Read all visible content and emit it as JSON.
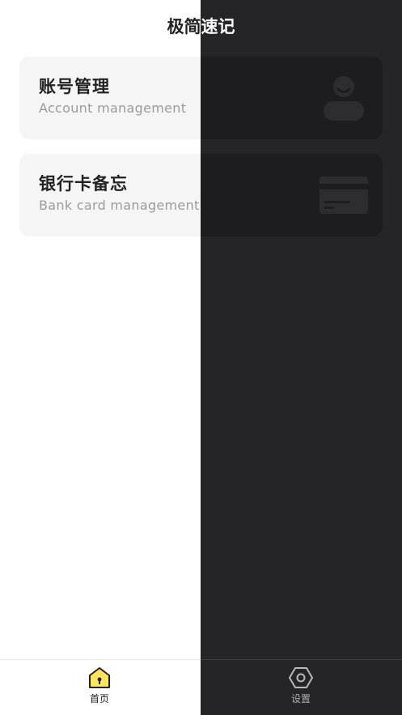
{
  "header": {
    "title": "极简速记"
  },
  "cards": [
    {
      "title": "账号管理",
      "subtitle": "Account management",
      "icon": "user-icon"
    },
    {
      "title": "银行卡备忘",
      "subtitle": "Bank card management",
      "icon": "bank-card-icon"
    }
  ],
  "tabbar": {
    "items": [
      {
        "label": "首页",
        "icon": "home-icon",
        "active": true
      },
      {
        "label": "设置",
        "icon": "settings-icon",
        "active": false
      }
    ]
  },
  "colors": {
    "accent": "#FFE45C",
    "dark_panel": "#252527",
    "card_light": "#F5F5F5"
  }
}
